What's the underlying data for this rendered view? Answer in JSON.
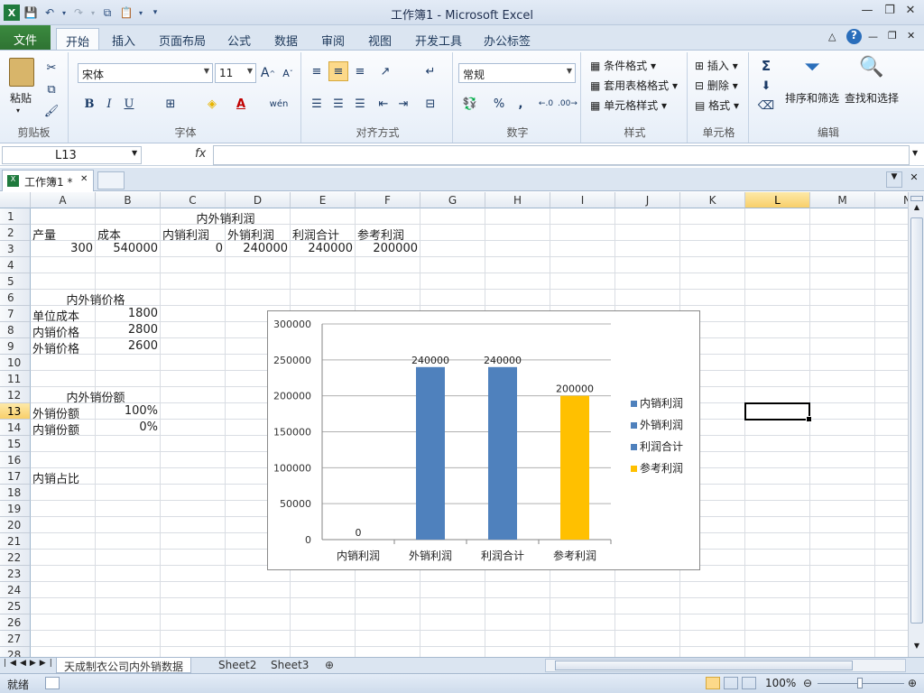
{
  "window": {
    "title": "工作簿1 - Microsoft Excel"
  },
  "ribbon_tabs": [
    "文件",
    "开始",
    "插入",
    "页面布局",
    "公式",
    "数据",
    "审阅",
    "视图",
    "开发工具",
    "办公标签"
  ],
  "font": {
    "name": "宋体",
    "size": "11",
    "bold": "B",
    "italic": "I",
    "underline": "U"
  },
  "number_format": "常规",
  "groups": {
    "clipboard": "剪贴板",
    "font": "字体",
    "alignment": "对齐方式",
    "number": "数字",
    "styles": "样式",
    "cells": "单元格",
    "editing": "编辑"
  },
  "buttons": {
    "paste": "粘贴",
    "conditional_format": "条件格式",
    "table_format": "套用表格格式",
    "cell_style": "单元格样式",
    "insert": "插入",
    "delete": "删除",
    "format": "格式",
    "sort_filter": "排序和筛选",
    "find_select": "查找和选择",
    "percent": "%",
    "comma": ",",
    "sigma": "Σ"
  },
  "formula_bar": {
    "name_box": "L13",
    "fx": "fx",
    "formula": ""
  },
  "workbook_tab": "工作簿1 *",
  "columns": [
    "A",
    "B",
    "C",
    "D",
    "E",
    "F",
    "G",
    "H",
    "I",
    "J",
    "K",
    "L",
    "M",
    "N"
  ],
  "rows": [
    "1",
    "2",
    "3",
    "4",
    "5",
    "6",
    "7",
    "8",
    "9",
    "10",
    "11",
    "12",
    "13",
    "14",
    "15",
    "16",
    "17",
    "18",
    "19",
    "20",
    "21",
    "22",
    "23",
    "24",
    "25",
    "26",
    "27",
    "28"
  ],
  "cells": {
    "c1": "内外销利润",
    "a2": "产量",
    "b2": "成本",
    "c2": "内销利润",
    "d2": "外销利润",
    "e2": "利润合计",
    "f2": "参考利润",
    "a3": "300",
    "b3": "540000",
    "c3": "0",
    "d3": "240000",
    "e3": "240000",
    "f3": "200000",
    "a6": "内外销价格",
    "a7": "单位成本",
    "b7": "1800",
    "a8": "内销价格",
    "b8": "2800",
    "a9": "外销价格",
    "b9": "2600",
    "a12": "内外销份额",
    "a13": "外销份额",
    "b13": "100%",
    "a14": "内销份额",
    "b14": "0%",
    "a17": "内销占比"
  },
  "chart_data": {
    "type": "bar",
    "categories": [
      "内销利润",
      "外销利润",
      "利润合计",
      "参考利润"
    ],
    "values": [
      0,
      240000,
      240000,
      200000
    ],
    "data_labels": [
      "0",
      "240000",
      "240000",
      "200000"
    ],
    "bar_colors": [
      "#4f81bd",
      "#4f81bd",
      "#4f81bd",
      "#ffc000"
    ],
    "legend": [
      {
        "name": "内销利润",
        "color": "#4f81bd"
      },
      {
        "name": "外销利润",
        "color": "#4f81bd"
      },
      {
        "name": "利润合计",
        "color": "#4f81bd"
      },
      {
        "name": "参考利润",
        "color": "#ffc000"
      }
    ],
    "legend_position": "right",
    "ylim": [
      0,
      300000
    ],
    "yticks": [
      0,
      50000,
      100000,
      150000,
      200000,
      250000,
      300000
    ],
    "grid": true,
    "title": "",
    "xlabel": "",
    "ylabel": ""
  },
  "sheets": [
    "天成制衣公司内外销数据",
    "Sheet2",
    "Sheet3"
  ],
  "status": {
    "mode": "就绪",
    "zoom": "100%"
  }
}
